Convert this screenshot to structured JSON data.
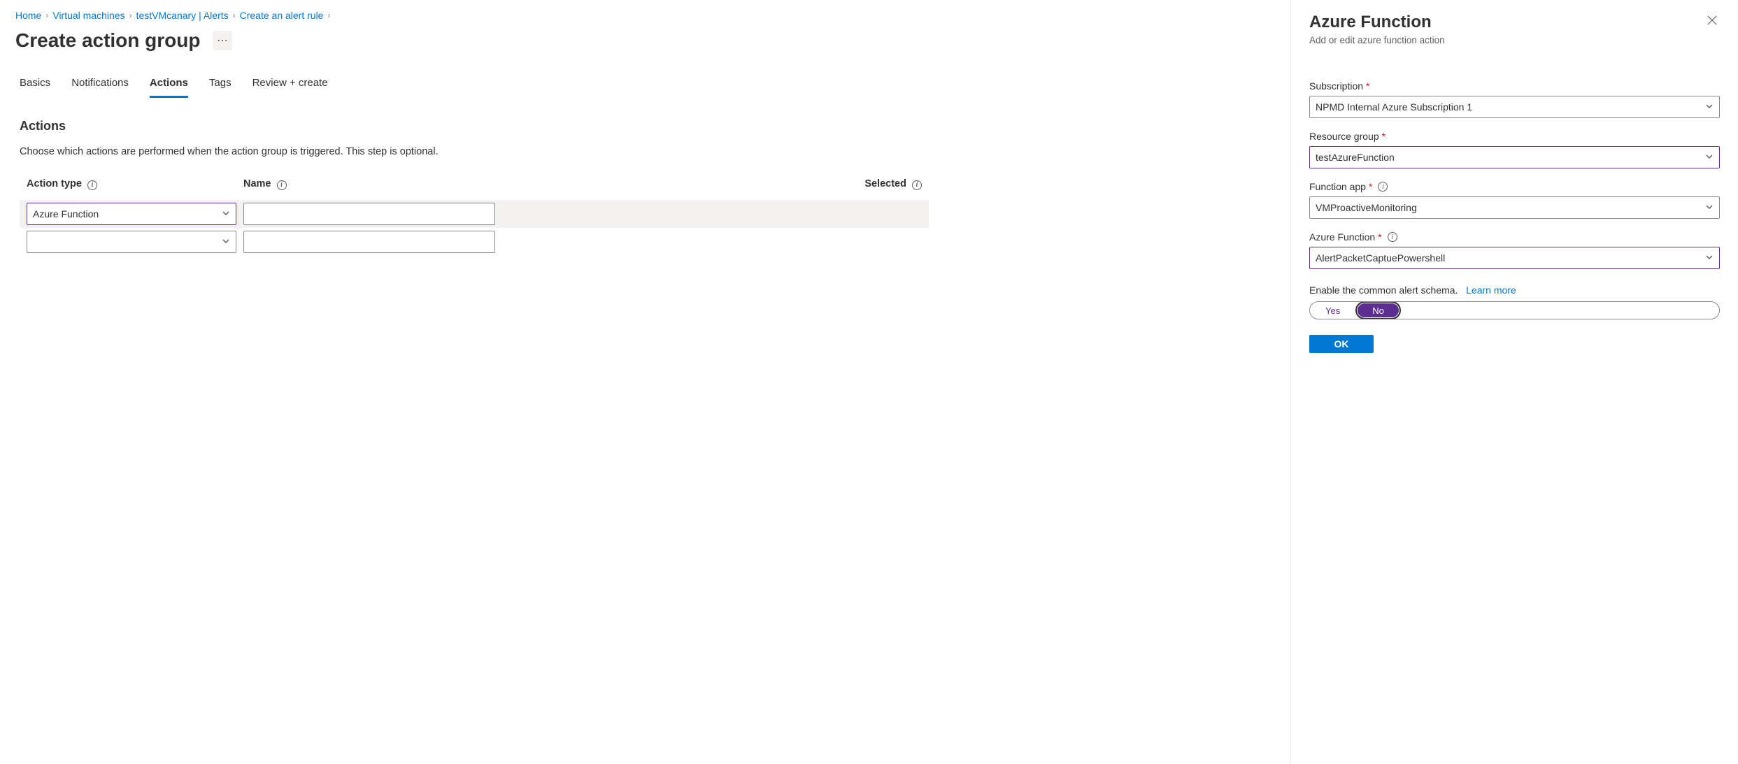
{
  "breadcrumb": [
    {
      "label": "Home"
    },
    {
      "label": "Virtual machines"
    },
    {
      "label": "testVMcanary | Alerts"
    },
    {
      "label": "Create an alert rule"
    }
  ],
  "page_title": "Create action group",
  "tabs": [
    {
      "label": "Basics",
      "active": false
    },
    {
      "label": "Notifications",
      "active": false
    },
    {
      "label": "Actions",
      "active": true
    },
    {
      "label": "Tags",
      "active": false
    },
    {
      "label": "Review + create",
      "active": false
    }
  ],
  "actions_section": {
    "heading": "Actions",
    "description": "Choose which actions are performed when the action group is triggered. This step is optional.",
    "columns": {
      "type": "Action type",
      "name": "Name",
      "selected": "Selected"
    },
    "rows": [
      {
        "type": "Azure Function",
        "name": "",
        "highlight": true
      },
      {
        "type": "",
        "name": "",
        "highlight": false
      }
    ]
  },
  "panel": {
    "title": "Azure Function",
    "subtitle": "Add or edit azure function action",
    "fields": {
      "subscription": {
        "label": "Subscription",
        "value": "NPMD Internal Azure Subscription 1",
        "required": true,
        "info": false,
        "purple": false
      },
      "resource_group": {
        "label": "Resource group",
        "value": "testAzureFunction",
        "required": true,
        "info": false,
        "purple": true
      },
      "function_app": {
        "label": "Function app",
        "value": "VMProactiveMonitoring",
        "required": true,
        "info": true,
        "purple": false
      },
      "azure_function": {
        "label": "Azure Function",
        "value": "AlertPacketCaptuePowershell",
        "required": true,
        "info": true,
        "purple": true
      }
    },
    "schema_text": "Enable the common alert schema.",
    "learn_more": "Learn more",
    "toggle": {
      "yes": "Yes",
      "no": "No",
      "selected": "no"
    },
    "ok": "OK"
  }
}
